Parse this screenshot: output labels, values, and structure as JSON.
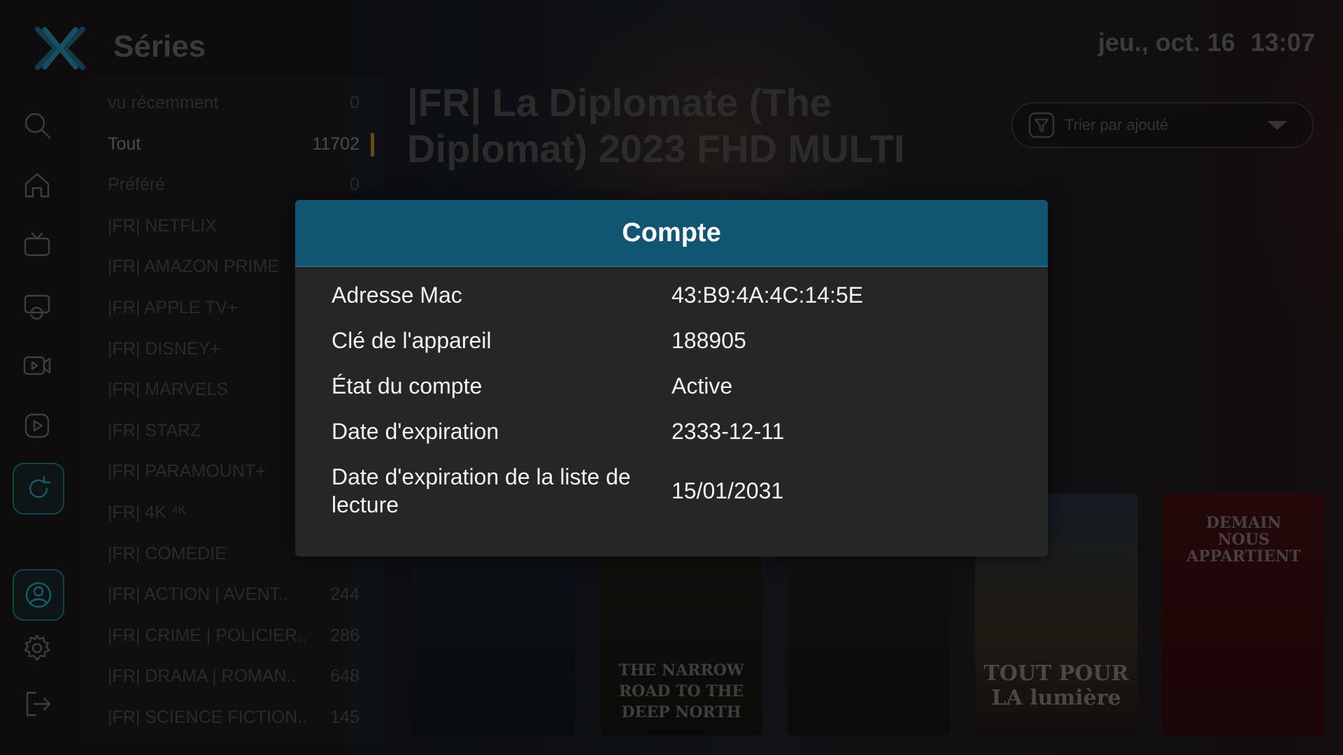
{
  "header": {
    "title": "Séries",
    "date": "jeu., oct. 16",
    "time": "13:07"
  },
  "sidebar": {
    "items": [
      {
        "icon": "search-icon"
      },
      {
        "icon": "home-icon"
      },
      {
        "icon": "tv-icon"
      },
      {
        "icon": "replay-tv-icon"
      },
      {
        "icon": "movie-icon"
      },
      {
        "icon": "play-icon"
      },
      {
        "icon": "refresh-icon"
      },
      {
        "icon": "account-icon"
      },
      {
        "icon": "settings-icon"
      },
      {
        "icon": "logout-icon"
      }
    ]
  },
  "categories": [
    {
      "label": "vu récemment",
      "count": "0"
    },
    {
      "label": "Tout",
      "count": "11702"
    },
    {
      "label": "Préféré",
      "count": "0"
    },
    {
      "label": "|FR| NETFLIX",
      "count": ""
    },
    {
      "label": "|FR| AMAZON PRIME",
      "count": ""
    },
    {
      "label": "|FR| APPLE TV+",
      "count": ""
    },
    {
      "label": "|FR| DISNEY+",
      "count": ""
    },
    {
      "label": "|FR| MARVELS",
      "count": ""
    },
    {
      "label": "|FR| STARZ",
      "count": ""
    },
    {
      "label": "|FR| PARAMOUNT+",
      "count": ""
    },
    {
      "label": "|FR| 4K ⁴ᴷ",
      "count": ""
    },
    {
      "label": "|FR| COMEDIE",
      "count": ""
    },
    {
      "label": "|FR| ACTION | AVENT..",
      "count": "244"
    },
    {
      "label": "|FR| CRIME | POLICIER..",
      "count": "286"
    },
    {
      "label": "|FR| DRAMA | ROMAN..",
      "count": "648"
    },
    {
      "label": "|FR| SCIENCE FICTION..",
      "count": "145"
    }
  ],
  "content": {
    "title": "|FR| La Diplomate (The Diplomat) 2023 FHD MULTI",
    "sort_label": "Trier par ajouté"
  },
  "posters": [
    {
      "text": ""
    },
    {
      "text": "THE NARROW ROAD TO THE DEEP NORTH"
    },
    {
      "text": ""
    },
    {
      "text": "TOUT POUR LA lumière"
    },
    {
      "text": "DEMAIN NOUS APPARTIENT"
    }
  ],
  "modal": {
    "title": "Compte",
    "rows": [
      {
        "label": "Adresse Mac",
        "value": "43:B9:4A:4C:14:5E"
      },
      {
        "label": "Clé de l'appareil",
        "value": "188905"
      },
      {
        "label": "État du compte",
        "value": "Active"
      },
      {
        "label": "Date d'expiration",
        "value": "2333-12-11"
      },
      {
        "label": "Date d'expiration de la liste de lecture",
        "value": "15/01/2031"
      }
    ]
  },
  "colors": {
    "modal_header": "#105572",
    "accent": "#2aa8b5",
    "selected_marker": "#b78a1b"
  }
}
